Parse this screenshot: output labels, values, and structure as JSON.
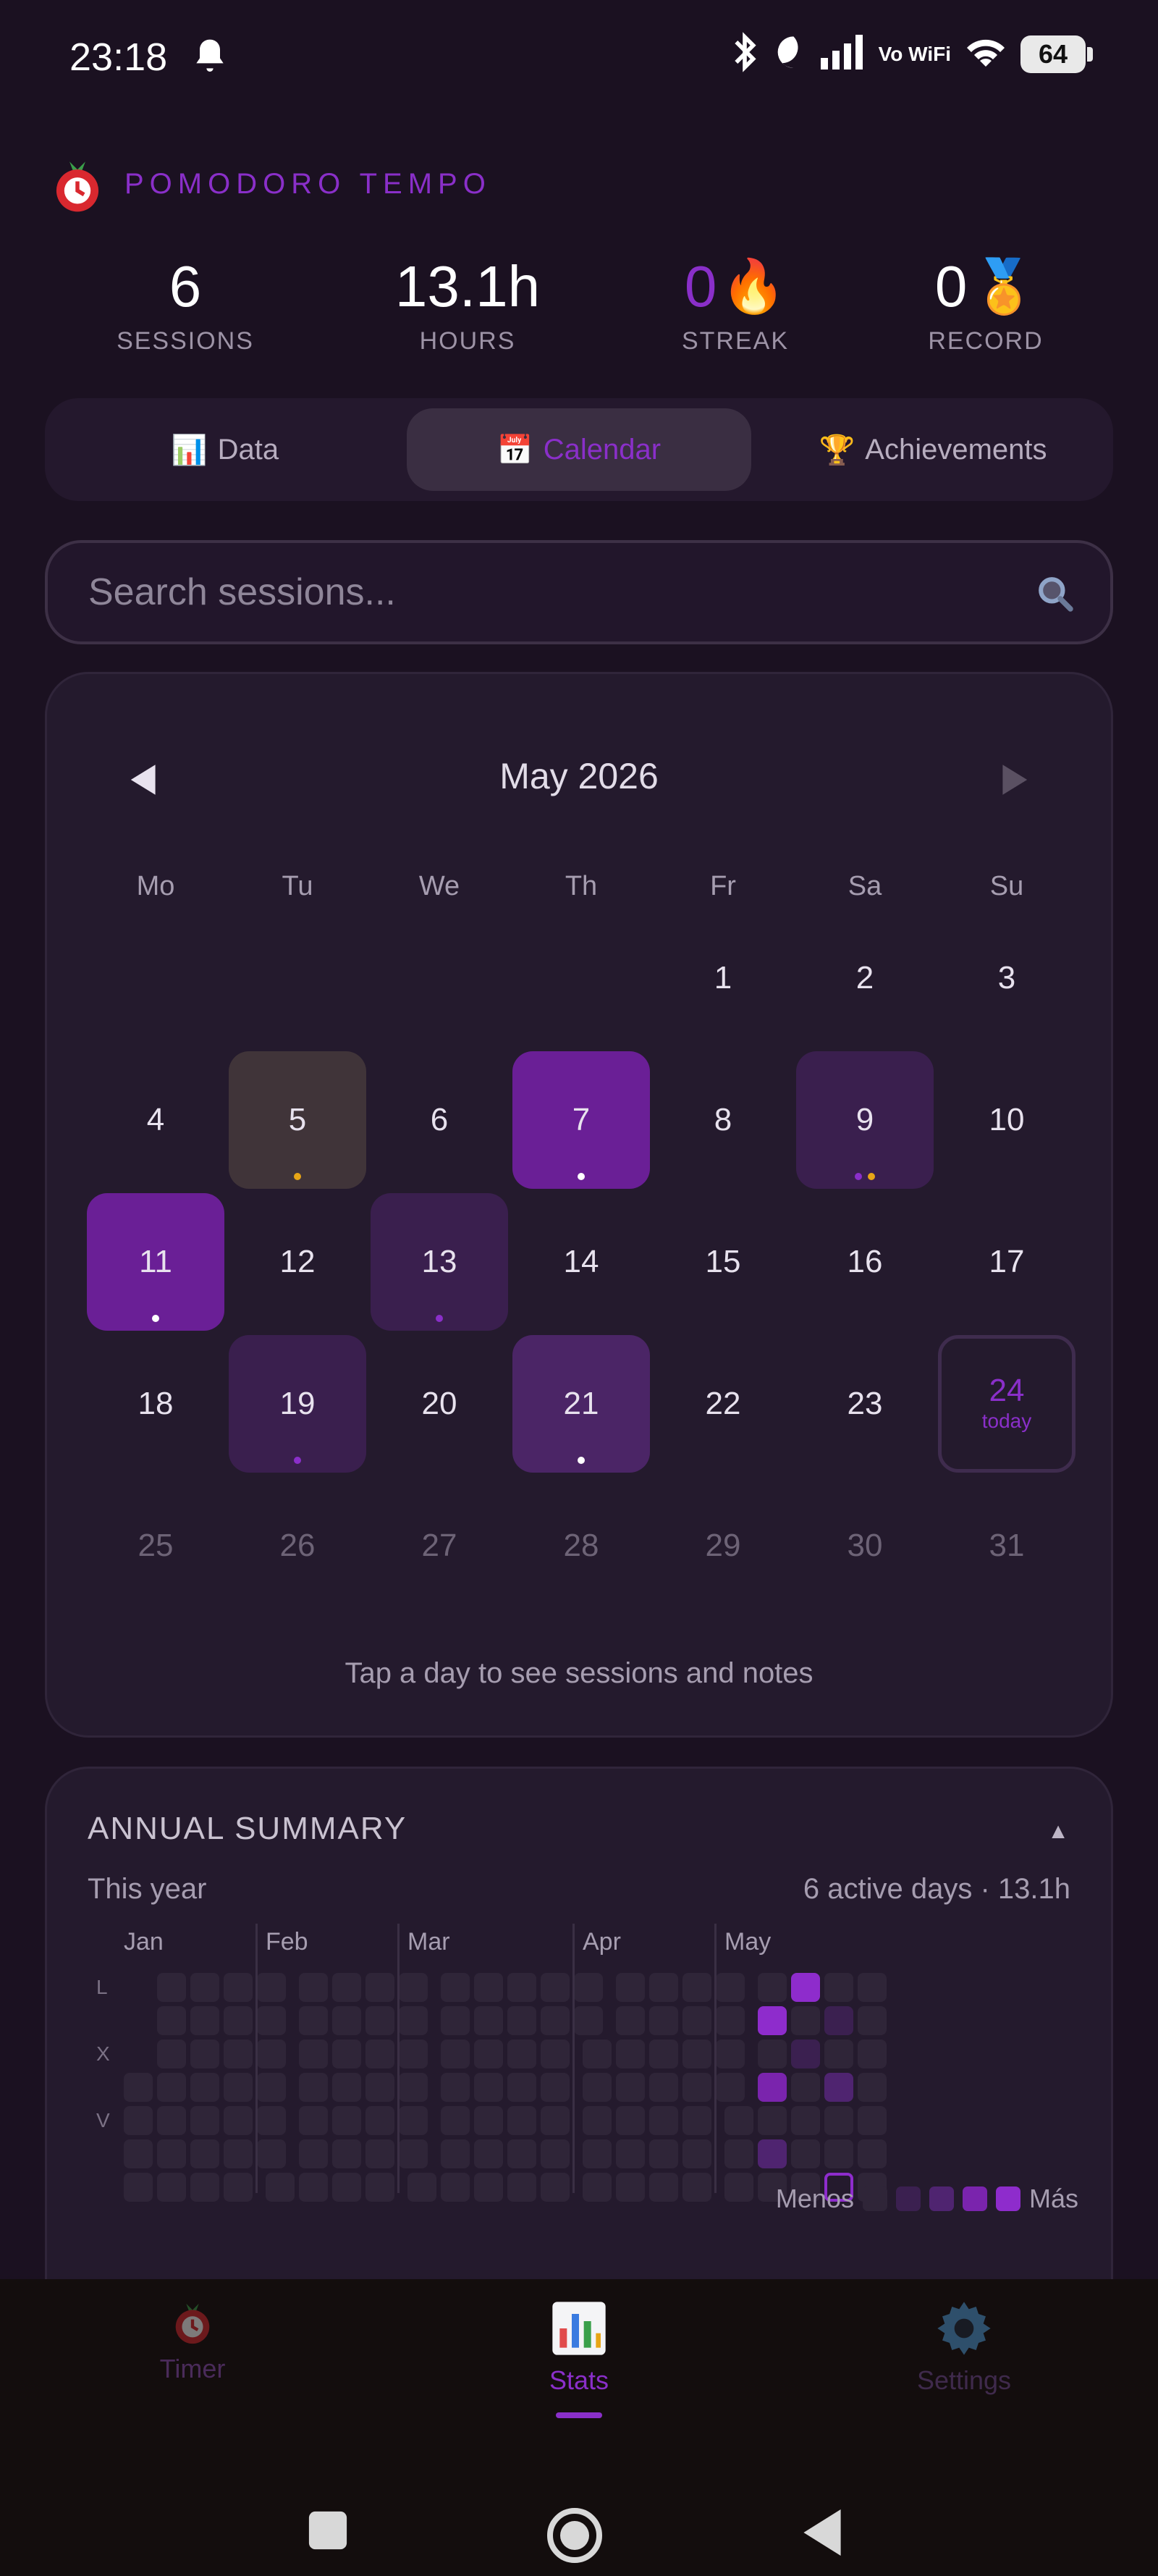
{
  "status_bar": {
    "time": "23:18",
    "vowifi": "Vo WiFi",
    "battery": "64"
  },
  "header": {
    "app_title": "POMODORO TEMPO",
    "logo_icon": "tomato-timer-icon"
  },
  "stats": [
    {
      "value": "6",
      "label": "SESSIONS",
      "emoji": ""
    },
    {
      "value": "13.1h",
      "label": "HOURS",
      "emoji": ""
    },
    {
      "value": "0",
      "label": "STREAK",
      "emoji": "🔥"
    },
    {
      "value": "0",
      "label": "RECORD",
      "emoji": "🏅"
    }
  ],
  "tabs": [
    {
      "label": "Data",
      "emoji": "📊",
      "active": false
    },
    {
      "label": "Calendar",
      "emoji": "📅",
      "active": true
    },
    {
      "label": "Achievements",
      "emoji": "🏆",
      "active": false
    }
  ],
  "search": {
    "placeholder": "Search sessions..."
  },
  "calendar": {
    "month_label": "May 2026",
    "weekdays": [
      "Mo",
      "Tu",
      "We",
      "Th",
      "Fr",
      "Sa",
      "Su"
    ],
    "weeks": [
      [
        "",
        "",
        "",
        "",
        "1",
        "2",
        "3"
      ],
      [
        "4",
        "5",
        "6",
        "7",
        "8",
        "9",
        "10"
      ],
      [
        "11",
        "12",
        "13",
        "14",
        "15",
        "16",
        "17"
      ],
      [
        "18",
        "19",
        "20",
        "21",
        "22",
        "23",
        "24"
      ],
      [
        "25",
        "26",
        "27",
        "28",
        "29",
        "30",
        "31"
      ]
    ],
    "highlighted_days": {
      "5": {
        "level": "gray",
        "dots": [
          "#e7a516"
        ]
      },
      "7": {
        "level": 3,
        "dots": [
          "#ffffff"
        ]
      },
      "9": {
        "level": 1,
        "dots": [
          "#8a2fc9",
          "#e7a516"
        ]
      },
      "11": {
        "level": 3,
        "dots": [
          "#ffffff"
        ]
      },
      "13": {
        "level": 1,
        "dots": [
          "#8a2fc9"
        ]
      },
      "19": {
        "level": 1,
        "dots": [
          "#8a2fc9"
        ]
      },
      "21": {
        "level": 2,
        "dots": [
          "#ffffff"
        ]
      }
    },
    "today": "24",
    "today_label": "today",
    "future_days_from": 25,
    "hint": "Tap a day to see sessions and notes"
  },
  "annual_summary": {
    "title": "ANNUAL SUMMARY",
    "subtitle": "This year",
    "stats": "6 active days · 13.1h",
    "months": [
      "Jan",
      "Feb",
      "Mar",
      "Apr",
      "May"
    ],
    "day_labels": [
      "L",
      "X",
      "V"
    ],
    "legend_less": "Menos",
    "legend_more": "Más",
    "active_days": [
      {
        "date": "2026-05-05",
        "level": 4
      },
      {
        "date": "2026-05-07",
        "level": 3
      },
      {
        "date": "2026-05-09",
        "level": 2
      },
      {
        "date": "2026-05-11",
        "level": 4
      },
      {
        "date": "2026-05-13",
        "level": 1
      },
      {
        "date": "2026-05-19",
        "level": 1
      },
      {
        "date": "2026-05-21",
        "level": 2
      }
    ],
    "today": "2026-05-24"
  },
  "bottom_nav": [
    {
      "label": "Timer",
      "icon": "tomato-timer-icon",
      "active": false
    },
    {
      "label": "Stats",
      "icon": "bar-chart-icon",
      "active": true
    },
    {
      "label": "Settings",
      "icon": "gear-icon",
      "active": false
    }
  ],
  "colors": {
    "accent": "#8a2fc9",
    "background": "#1b1121",
    "card": "#241a2d"
  }
}
